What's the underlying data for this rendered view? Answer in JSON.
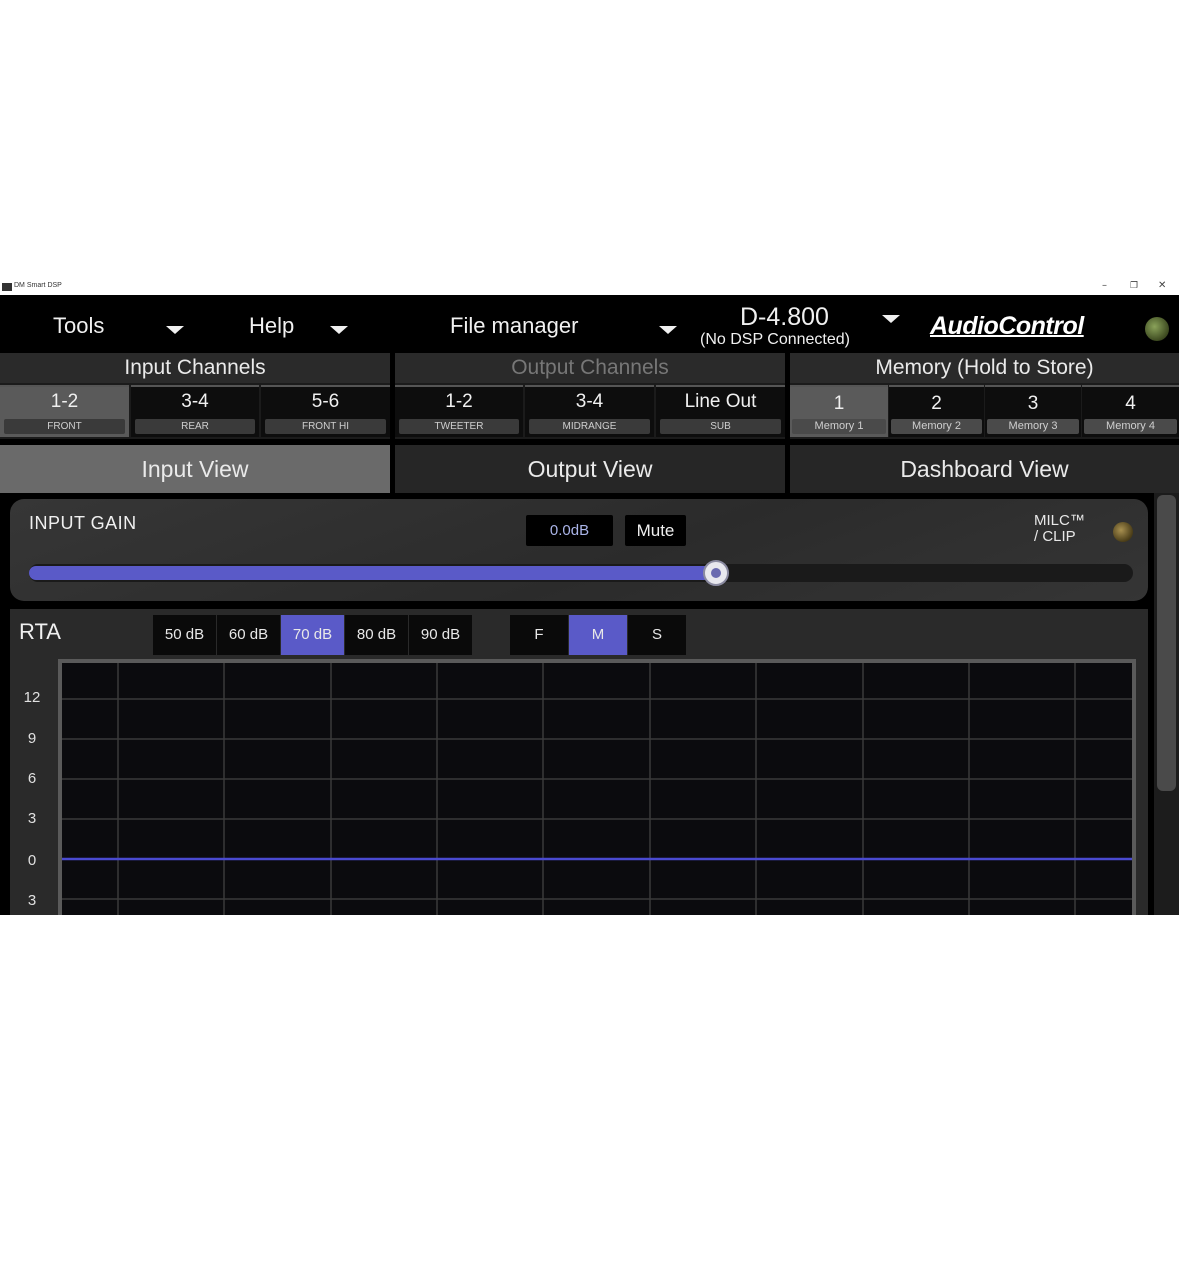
{
  "window": {
    "title": "DM Smart DSP",
    "controls": {
      "minimize": "–",
      "maximize": "❐",
      "close": "✕"
    }
  },
  "menu": {
    "tools": "Tools",
    "help": "Help",
    "file_manager": "File manager",
    "device_name": "D-4.800",
    "device_status": "(No DSP Connected)",
    "brand": "AudioControl"
  },
  "input_channels": {
    "header": "Input Channels",
    "items": [
      {
        "num": "1-2",
        "label": "FRONT",
        "active": true
      },
      {
        "num": "3-4",
        "label": "REAR",
        "active": false
      },
      {
        "num": "5-6",
        "label": "FRONT HI",
        "active": false
      }
    ]
  },
  "output_channels": {
    "header": "Output Channels",
    "items": [
      {
        "num": "1-2",
        "label": "TWEETER"
      },
      {
        "num": "3-4",
        "label": "MIDRANGE"
      },
      {
        "num": "Line Out",
        "label": "SUB"
      }
    ]
  },
  "memory": {
    "header": "Memory (Hold to Store)",
    "items": [
      {
        "num": "1",
        "label": "Memory 1",
        "active": true
      },
      {
        "num": "2",
        "label": "Memory 2",
        "active": false
      },
      {
        "num": "3",
        "label": "Memory 3",
        "active": false
      },
      {
        "num": "4",
        "label": "Memory 4",
        "active": false
      }
    ]
  },
  "views": {
    "input": "Input View",
    "output": "Output View",
    "dashboard": "Dashboard View",
    "active": "input"
  },
  "gain": {
    "title": "INPUT GAIN",
    "value": "0.0dB",
    "mute": "Mute",
    "milc_line1": "MILC™",
    "milc_line2": "/ CLIP",
    "level": 0.622
  },
  "rta": {
    "label": "RTA",
    "ranges": [
      "50 dB",
      "60 dB",
      "70 dB",
      "80 dB",
      "90 dB"
    ],
    "active_range": "70 dB",
    "speeds": [
      "F",
      "M",
      "S"
    ],
    "active_speed": "M",
    "y_ticks": [
      "12",
      "9",
      "6",
      "3",
      "0",
      "3"
    ]
  },
  "colors": {
    "accent": "#5a5ac8",
    "background": "#000000",
    "panel": "#2a2a2a"
  }
}
